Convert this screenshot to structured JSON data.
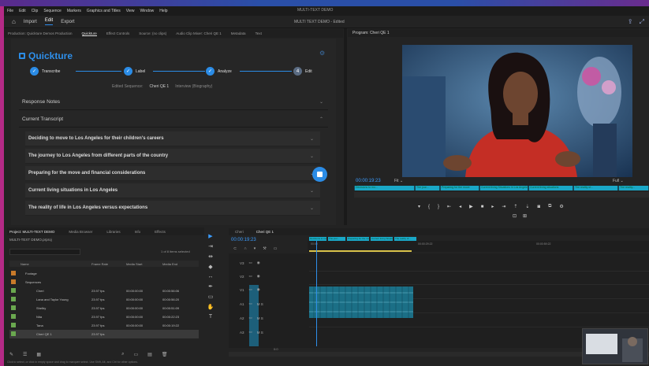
{
  "menu": [
    "File",
    "Edit",
    "Clip",
    "Sequence",
    "Markers",
    "Graphics and Titles",
    "View",
    "Window",
    "Help"
  ],
  "window_title": "MULTI-TEXT DEMO",
  "workspace": {
    "home": "home-icon",
    "tabs": [
      "Import",
      "Edit",
      "Export"
    ],
    "active": "Edit",
    "title": "MULTI TEXT DEMO - Edited"
  },
  "left_tabs": [
    "Production: Quickture Demos Production",
    "Quickture",
    "Effect Controls",
    "Source: (no clips)",
    "Audio Clip Mixer: Cheri QE 1",
    "Metadata",
    "Text"
  ],
  "quickture": {
    "logo": "Quickture",
    "steps": [
      {
        "label": "Transcribe",
        "done": true
      },
      {
        "label": "Label",
        "done": true
      },
      {
        "label": "Analyze",
        "done": true
      },
      {
        "label": "Edit",
        "done": false
      }
    ],
    "sequence_label": "Edited Sequence:",
    "sequence_current": "Cheri QE 1",
    "sequence_type": "Interview (Biography)",
    "sections": [
      "Response Notes",
      "Current Transcript"
    ],
    "topics": [
      "Deciding to move to Los Angeles for their children's careers",
      "The journey to Los Angeles from different parts of the country",
      "Preparing for the move and financial considerations",
      "Current living situations in Los Angeles",
      "The reality of life in Los Angeles versus expectations"
    ]
  },
  "program": {
    "tab": "Program: Cheri QE 1",
    "timecode": "00:00:19:23",
    "fit": "Fit",
    "resolution": "Full",
    "markers": [
      "Decisions to mo...",
      "The jour...",
      "Preparing for the move",
      "Current living Situations in Los Angeles",
      "Current living situations",
      "The reality of...",
      "The reality..."
    ]
  },
  "project": {
    "tabs": [
      "Project: MULTI-TEXT DEMO",
      "Media Browser",
      "Libraries",
      "Info",
      "Effects"
    ],
    "name": "MULTI-TEXT DEMO.prproj",
    "count": "1 of 8 items selected",
    "columns": [
      "Name",
      "Frame Rate",
      "Media Start",
      "Media End"
    ],
    "rows": [
      {
        "name": "Footage",
        "color": "#c97a2a",
        "rate": "",
        "start": "",
        "end": ""
      },
      {
        "name": "Sequences",
        "color": "#c97a2a",
        "rate": "",
        "start": "",
        "end": ""
      },
      {
        "name": "Cheri",
        "color": "#6aa84f",
        "rate": "23.97 fps",
        "start": "00:00:00:00",
        "end": "00:00:56:06"
      },
      {
        "name": "Lana and Taylor Young",
        "color": "#6aa84f",
        "rate": "23.97 fps",
        "start": "00:00:00:00",
        "end": "00:00:56:20"
      },
      {
        "name": "Shelby",
        "color": "#6aa84f",
        "rate": "23.97 fps",
        "start": "00:00:00:00",
        "end": "00:00:51:09"
      },
      {
        "name": "Nita",
        "color": "#6aa84f",
        "rate": "23.97 fps",
        "start": "00:00:00:00",
        "end": "00:00:22:23"
      },
      {
        "name": "Tana",
        "color": "#6aa84f",
        "rate": "23.97 fps",
        "start": "00:00:00:00",
        "end": "00:00:19:22"
      },
      {
        "name": "Cheri QE 1",
        "color": "#6aa84f",
        "rate": "23.97 fps",
        "start": "",
        "end": ""
      }
    ]
  },
  "timeline": {
    "tabs": [
      "Cheri",
      "Cheri QE 1"
    ],
    "active": "Cheri QE 1",
    "timecode": "00:00:19:23",
    "ruler": [
      "00:00",
      "00:00:29:22",
      "00:00:59:22"
    ],
    "tracks": [
      "V3",
      "V2",
      "V1",
      "A1",
      "A2",
      "A3"
    ],
    "count": "0:0"
  },
  "status": "Click to select, or click in empty space and drag to marquee select. Use Shift, Alt, and Ctrl for other options."
}
